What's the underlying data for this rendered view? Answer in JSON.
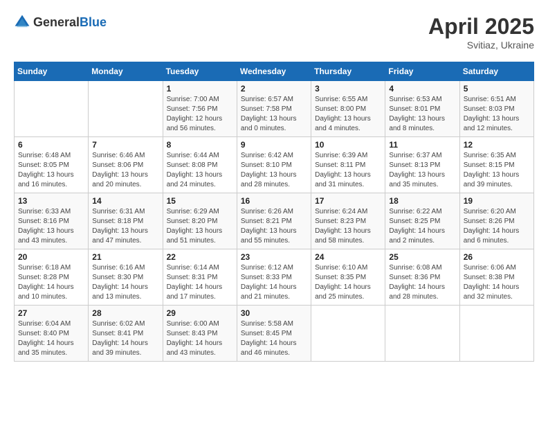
{
  "header": {
    "logo_general": "General",
    "logo_blue": "Blue",
    "month_year": "April 2025",
    "location": "Svitiaz, Ukraine"
  },
  "days_of_week": [
    "Sunday",
    "Monday",
    "Tuesday",
    "Wednesday",
    "Thursday",
    "Friday",
    "Saturday"
  ],
  "weeks": [
    [
      {
        "day": "",
        "info": ""
      },
      {
        "day": "",
        "info": ""
      },
      {
        "day": "1",
        "info": "Sunrise: 7:00 AM\nSunset: 7:56 PM\nDaylight: 12 hours and 56 minutes."
      },
      {
        "day": "2",
        "info": "Sunrise: 6:57 AM\nSunset: 7:58 PM\nDaylight: 13 hours and 0 minutes."
      },
      {
        "day": "3",
        "info": "Sunrise: 6:55 AM\nSunset: 8:00 PM\nDaylight: 13 hours and 4 minutes."
      },
      {
        "day": "4",
        "info": "Sunrise: 6:53 AM\nSunset: 8:01 PM\nDaylight: 13 hours and 8 minutes."
      },
      {
        "day": "5",
        "info": "Sunrise: 6:51 AM\nSunset: 8:03 PM\nDaylight: 13 hours and 12 minutes."
      }
    ],
    [
      {
        "day": "6",
        "info": "Sunrise: 6:48 AM\nSunset: 8:05 PM\nDaylight: 13 hours and 16 minutes."
      },
      {
        "day": "7",
        "info": "Sunrise: 6:46 AM\nSunset: 8:06 PM\nDaylight: 13 hours and 20 minutes."
      },
      {
        "day": "8",
        "info": "Sunrise: 6:44 AM\nSunset: 8:08 PM\nDaylight: 13 hours and 24 minutes."
      },
      {
        "day": "9",
        "info": "Sunrise: 6:42 AM\nSunset: 8:10 PM\nDaylight: 13 hours and 28 minutes."
      },
      {
        "day": "10",
        "info": "Sunrise: 6:39 AM\nSunset: 8:11 PM\nDaylight: 13 hours and 31 minutes."
      },
      {
        "day": "11",
        "info": "Sunrise: 6:37 AM\nSunset: 8:13 PM\nDaylight: 13 hours and 35 minutes."
      },
      {
        "day": "12",
        "info": "Sunrise: 6:35 AM\nSunset: 8:15 PM\nDaylight: 13 hours and 39 minutes."
      }
    ],
    [
      {
        "day": "13",
        "info": "Sunrise: 6:33 AM\nSunset: 8:16 PM\nDaylight: 13 hours and 43 minutes."
      },
      {
        "day": "14",
        "info": "Sunrise: 6:31 AM\nSunset: 8:18 PM\nDaylight: 13 hours and 47 minutes."
      },
      {
        "day": "15",
        "info": "Sunrise: 6:29 AM\nSunset: 8:20 PM\nDaylight: 13 hours and 51 minutes."
      },
      {
        "day": "16",
        "info": "Sunrise: 6:26 AM\nSunset: 8:21 PM\nDaylight: 13 hours and 55 minutes."
      },
      {
        "day": "17",
        "info": "Sunrise: 6:24 AM\nSunset: 8:23 PM\nDaylight: 13 hours and 58 minutes."
      },
      {
        "day": "18",
        "info": "Sunrise: 6:22 AM\nSunset: 8:25 PM\nDaylight: 14 hours and 2 minutes."
      },
      {
        "day": "19",
        "info": "Sunrise: 6:20 AM\nSunset: 8:26 PM\nDaylight: 14 hours and 6 minutes."
      }
    ],
    [
      {
        "day": "20",
        "info": "Sunrise: 6:18 AM\nSunset: 8:28 PM\nDaylight: 14 hours and 10 minutes."
      },
      {
        "day": "21",
        "info": "Sunrise: 6:16 AM\nSunset: 8:30 PM\nDaylight: 14 hours and 13 minutes."
      },
      {
        "day": "22",
        "info": "Sunrise: 6:14 AM\nSunset: 8:31 PM\nDaylight: 14 hours and 17 minutes."
      },
      {
        "day": "23",
        "info": "Sunrise: 6:12 AM\nSunset: 8:33 PM\nDaylight: 14 hours and 21 minutes."
      },
      {
        "day": "24",
        "info": "Sunrise: 6:10 AM\nSunset: 8:35 PM\nDaylight: 14 hours and 25 minutes."
      },
      {
        "day": "25",
        "info": "Sunrise: 6:08 AM\nSunset: 8:36 PM\nDaylight: 14 hours and 28 minutes."
      },
      {
        "day": "26",
        "info": "Sunrise: 6:06 AM\nSunset: 8:38 PM\nDaylight: 14 hours and 32 minutes."
      }
    ],
    [
      {
        "day": "27",
        "info": "Sunrise: 6:04 AM\nSunset: 8:40 PM\nDaylight: 14 hours and 35 minutes."
      },
      {
        "day": "28",
        "info": "Sunrise: 6:02 AM\nSunset: 8:41 PM\nDaylight: 14 hours and 39 minutes."
      },
      {
        "day": "29",
        "info": "Sunrise: 6:00 AM\nSunset: 8:43 PM\nDaylight: 14 hours and 43 minutes."
      },
      {
        "day": "30",
        "info": "Sunrise: 5:58 AM\nSunset: 8:45 PM\nDaylight: 14 hours and 46 minutes."
      },
      {
        "day": "",
        "info": ""
      },
      {
        "day": "",
        "info": ""
      },
      {
        "day": "",
        "info": ""
      }
    ]
  ]
}
